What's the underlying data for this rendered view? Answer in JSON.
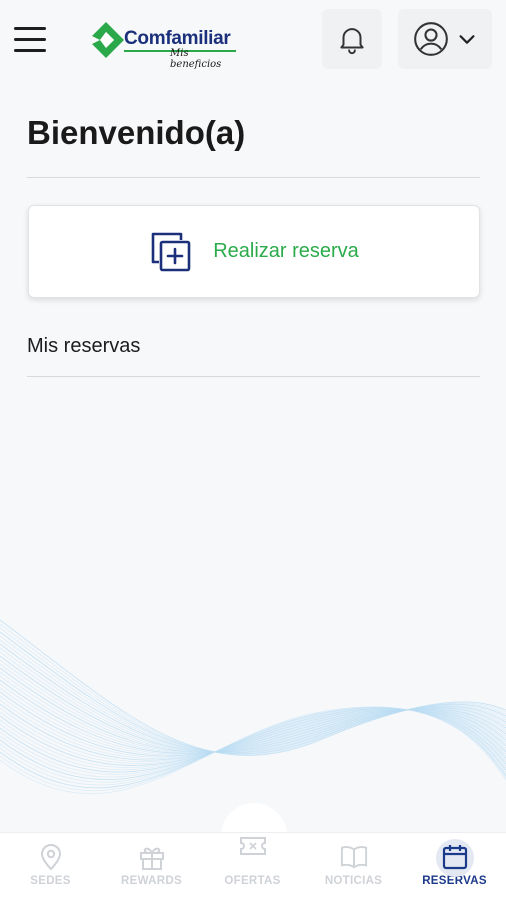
{
  "header": {
    "menu_icon": "hamburger-menu-icon",
    "logo": {
      "word": "Comfamiliar",
      "tagline": "Mis beneficios",
      "brand_green": "#2aa84a",
      "brand_blue": "#1b2f7a"
    },
    "notifications_icon": "bell-icon",
    "user_icon": "user-circle-icon",
    "user_menu_icon": "chevron-down-icon"
  },
  "main": {
    "title": "Bienvenido(a)",
    "reserve_card": {
      "icon": "add-copy-icon",
      "label": "Realizar reserva",
      "label_color": "#2bab4b"
    },
    "my_reservations_label": "Mis reservas"
  },
  "bottom_nav": {
    "active_color": "#1b3a8a",
    "inactive_color": "#cfd2d6",
    "items": [
      {
        "label": "SEDES",
        "icon": "map-pin-icon",
        "active": false
      },
      {
        "label": "REWARDS",
        "icon": "gift-icon",
        "active": false
      },
      {
        "label": "OFERTAS",
        "icon": "ticket-icon",
        "active": false
      },
      {
        "label": "NOTICIAS",
        "icon": "book-icon",
        "active": false
      },
      {
        "label": "RESERVAS",
        "icon": "calendar-icon",
        "active": true
      }
    ]
  }
}
